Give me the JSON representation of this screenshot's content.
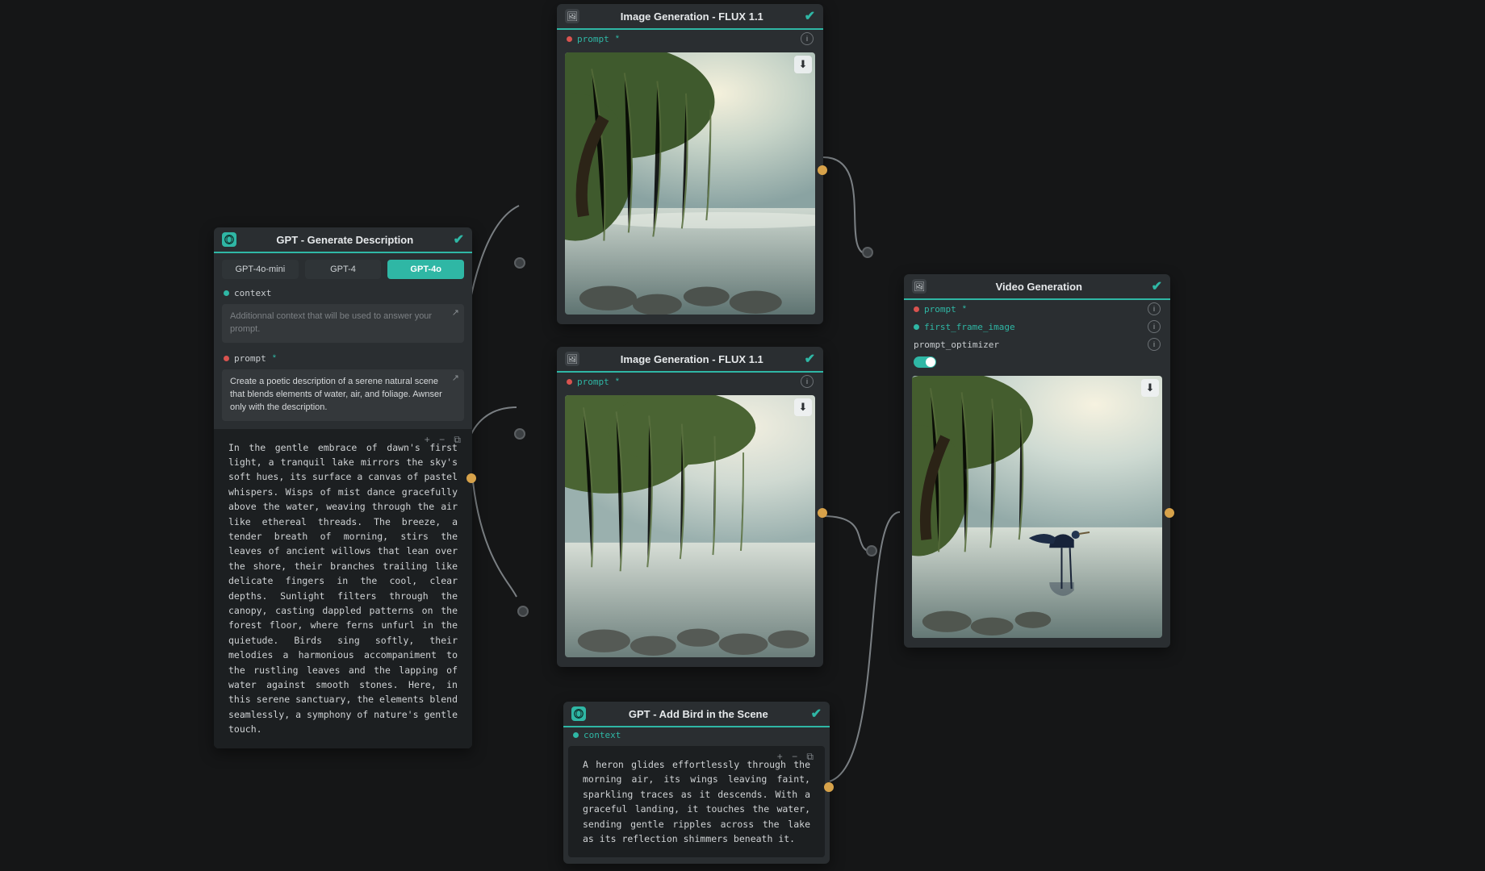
{
  "nodes": {
    "gpt_desc": {
      "title": "GPT - Generate Description",
      "tabs": [
        "GPT-4o-mini",
        "GPT-4",
        "GPT-4o"
      ],
      "active_tab": 2,
      "context_label": "context",
      "context_placeholder": "Additionnal context that will be used to answer your prompt.",
      "prompt_label": "prompt",
      "prompt_value": "Create a poetic description of a serene natural scene that blends elements of water, air, and foliage. Awnser only with the description.",
      "output_tools": "+  −  ⧉",
      "output": "In the gentle embrace of dawn's first light, a tranquil lake mirrors the sky's soft hues, its surface a canvas of pastel whispers. Wisps of mist dance gracefully above the water, weaving through the air like ethereal threads. The breeze, a tender breath of morning, stirs the leaves of ancient willows that lean over the shore, their branches trailing like delicate fingers in the cool, clear depths. Sunlight filters through the canopy, casting dappled patterns on the forest floor, where ferns unfurl in the quietude. Birds sing softly, their melodies a harmonious accompaniment to the rustling leaves and the lapping of water against smooth stones. Here, in this serene sanctuary, the elements blend seamlessly, a symphony of nature's gentle touch."
    },
    "flux1": {
      "title": "Image Generation - FLUX 1.1",
      "prompt_label": "prompt"
    },
    "flux2": {
      "title": "Image Generation - FLUX 1.1",
      "prompt_label": "prompt"
    },
    "gpt_bird": {
      "title": "GPT - Add Bird in the Scene",
      "context_label": "context",
      "output_tools": "+  −  ⧉",
      "output": "A heron glides effortlessly through the morning air, its wings leaving faint, sparkling traces as it descends. With a graceful landing, it touches the water, sending gentle ripples across the lake as its reflection shimmers beneath it."
    },
    "video": {
      "title": "Video Generation",
      "prompt_label": "prompt",
      "first_frame_label": "first_frame_image",
      "optimizer_label": "prompt_optimizer"
    }
  }
}
